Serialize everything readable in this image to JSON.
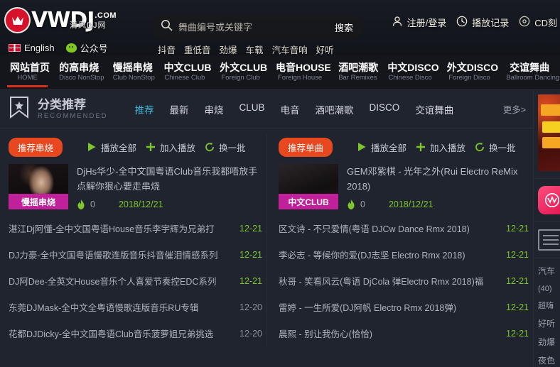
{
  "header": {
    "logo_text": "VWDJ",
    "logo_suffix": ".COM",
    "logo_cn": "清风DJ网",
    "sub_links": [
      {
        "icon": "uk-flag-icon",
        "label": "English"
      },
      {
        "icon": "wechat-icon",
        "label": "公众号"
      }
    ],
    "search": {
      "placeholder": "舞曲编号或关键字",
      "value": "",
      "button_label": "搜索"
    },
    "hot_tags": [
      "抖音",
      "重低音",
      "劲爆",
      "车载",
      "汽车音响",
      "好听"
    ],
    "top_right": [
      {
        "icon": "user-icon",
        "label": "注册/登录"
      },
      {
        "icon": "clock-icon",
        "label": "播放记录"
      },
      {
        "icon": "cd-icon",
        "label": "CD刻"
      }
    ]
  },
  "mainnav": [
    {
      "cn": "网站首页",
      "en": "HOME",
      "active": true
    },
    {
      "cn": "的高串烧",
      "en": "Disco NonStop",
      "active": false
    },
    {
      "cn": "慢摇串烧",
      "en": "Club NonStop",
      "active": false
    },
    {
      "cn": "中文CLUB",
      "en": "Chinese Club",
      "active": false
    },
    {
      "cn": "外文CLUB",
      "en": "Foreign Club",
      "active": false
    },
    {
      "cn": "电音HOUSE",
      "en": "Foreign House",
      "active": false
    },
    {
      "cn": "酒吧潮歌",
      "en": "Bar Remixes",
      "active": false
    },
    {
      "cn": "中文DISCO",
      "en": "Chinese Disco",
      "active": false
    },
    {
      "cn": "外文DISCO",
      "en": "Foreign Disco",
      "active": false
    },
    {
      "cn": "交谊舞曲",
      "en": "Ballroom Dancing",
      "active": false
    }
  ],
  "section": {
    "title_cn": "分类推荐",
    "title_en": "RECOMMENDED",
    "tabs": [
      {
        "label": "推荐",
        "active": true
      },
      {
        "label": "最新",
        "active": false
      },
      {
        "label": "串烧",
        "active": false
      },
      {
        "label": "CLUB",
        "active": false
      },
      {
        "label": "电音",
        "active": false
      },
      {
        "label": "酒吧潮歌",
        "active": false
      },
      {
        "label": "DISCO",
        "active": false
      },
      {
        "label": "交谊舞曲",
        "active": false
      }
    ],
    "more_label": "更多>"
  },
  "columns": {
    "left": {
      "pill_label": "推荐串烧",
      "actions": [
        {
          "icon": "play-icon",
          "label": "播放全部"
        },
        {
          "icon": "plus-icon",
          "label": "加入播放"
        },
        {
          "icon": "refresh-icon",
          "label": "换一批"
        }
      ],
      "featured": {
        "tag": "慢摇串烧",
        "title": "DjHs华少-全中文国粤语Club音乐我都唔放手点解你狠心要走串烧",
        "hot_count": "0",
        "date": "2018/12/21"
      },
      "rows": [
        {
          "title": "湛江Dj阿懂-全中文国粤语House音乐李宇辉为兄弟打",
          "date": "12-21",
          "fresh": true
        },
        {
          "title": "DJ力豪-全中文国粤语慢歌连版音乐抖音催泪情感系列",
          "date": "12-21",
          "fresh": true
        },
        {
          "title": "DJ阿Dee-全英文House音乐个人喜爱节奏控EDC系列",
          "date": "12-21",
          "fresh": true
        },
        {
          "title": "东莞DJMask-全中文全粤语慢歌连版音乐RU专辑",
          "date": "12-20",
          "fresh": false
        },
        {
          "title": "花都DJDicky-全中文国粤语Club音乐菠萝姐兄弟挑选",
          "date": "12-20",
          "fresh": false
        }
      ]
    },
    "right": {
      "pill_label": "推荐单曲",
      "actions": [
        {
          "icon": "play-icon",
          "label": "播放全部"
        },
        {
          "icon": "plus-icon",
          "label": "加入播放"
        },
        {
          "icon": "refresh-icon",
          "label": "换一批"
        }
      ],
      "featured": {
        "tag": "中文CLUB",
        "title": "GEM邓紫棋 - 光年之外(Rui Electro ReMix 2018)",
        "hot_count": "0",
        "date": "2018/12/21"
      },
      "rows": [
        {
          "title": "区文诗 - 不只爱情(粤语 DJCw Dance Rmx 2018)",
          "date": "12-21",
          "fresh": true
        },
        {
          "title": "李必志 - 等候你的爱(DJ志坚 Electro Rmx 2018)",
          "date": "12-21",
          "fresh": true
        },
        {
          "title": "秋哥 - 笑看风云(粤语 DjCola 弹Electro Rmx 2018)福",
          "date": "12-21",
          "fresh": true
        },
        {
          "title": "雷婷 - 一生所爱(DJ阿帆 Electro Rmx 2018弹)",
          "date": "12-21",
          "fresh": true
        },
        {
          "title": "晨熙 - 别让我伤心(恰恰)",
          "date": "12-21",
          "fresh": true
        }
      ]
    }
  },
  "sidebar": {
    "items": [
      {
        "label": "汽车"
      },
      {
        "label": "(40)"
      },
      {
        "label": "超嗨"
      },
      {
        "label": "好听"
      },
      {
        "label": "劲爆"
      },
      {
        "label": "夜色"
      }
    ]
  },
  "colors": {
    "accent_red": "#d4321f",
    "pill_orange": "#e8481f",
    "tab_active": "#3fb6d4",
    "date_green": "#7ec52b",
    "tag_magenta": "#c0219b",
    "page_bg": "#20242f"
  }
}
